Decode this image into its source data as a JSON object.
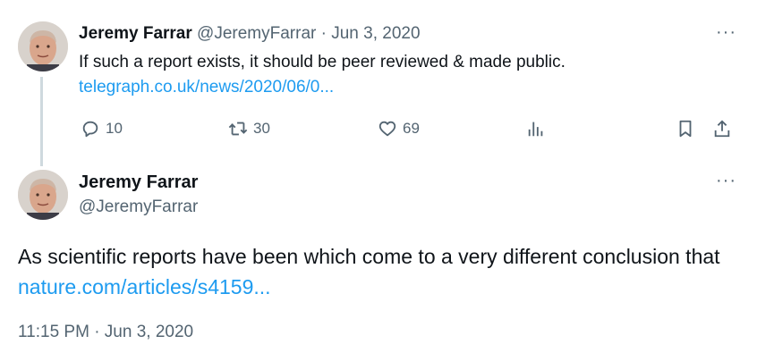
{
  "reply_tweet": {
    "author_name": "Jeremy Farrar",
    "author_handle": "@JeremyFarrar",
    "separator": "·",
    "date": "Jun 3, 2020",
    "text": "If such a report exists, it should be peer reviewed & made public.",
    "link": "telegraph.co.uk/news/2020/06/0...",
    "actions": {
      "replies": "10",
      "retweets": "30",
      "likes": "69"
    },
    "icons": [
      "reply-icon",
      "retweet-icon",
      "like-icon",
      "views-icon",
      "bookmark-icon",
      "share-icon",
      "more-icon"
    ]
  },
  "main_tweet": {
    "author_name": "Jeremy Farrar",
    "author_handle": "@JeremyFarrar",
    "text": "As scientific reports have been which come to a very different conclusion that",
    "link": "nature.com/articles/s4159...",
    "timestamp": "11:15 PM · Jun 3, 2020"
  },
  "colors": {
    "link": "#1d9bf0",
    "secondary_text": "#536471",
    "thread_line": "#cfd9de"
  }
}
